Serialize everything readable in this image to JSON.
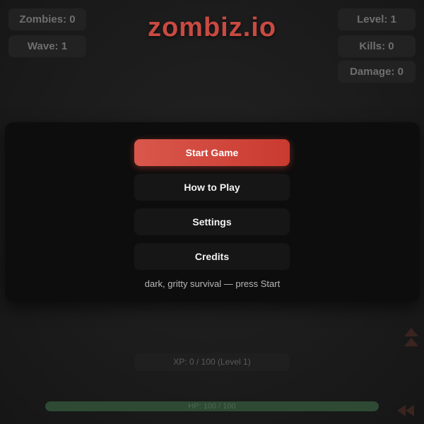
{
  "logo": {
    "text": "zombiz.io"
  },
  "hud": {
    "zombies": "Zombies: 0",
    "wave": "Wave: 1",
    "level": "Level: 1",
    "kills": "Kills: 0",
    "damage": "Damage: 0"
  },
  "menu": {
    "start": "Start Game",
    "howto": "How to Play",
    "settings": "Settings",
    "credits": "Credits",
    "tagline": "dark, gritty survival — press Start"
  },
  "xp": {
    "label": "XP: 0 / 100 (Level 1)"
  },
  "hp": {
    "label": "HP: 100 / 100",
    "fraction": 1.0,
    "color": "#2f4a34"
  },
  "colors": {
    "accent": "#c94a42",
    "start_button": "#d9574c"
  },
  "icons": {
    "arena_markers": "chevron-up-icon"
  }
}
